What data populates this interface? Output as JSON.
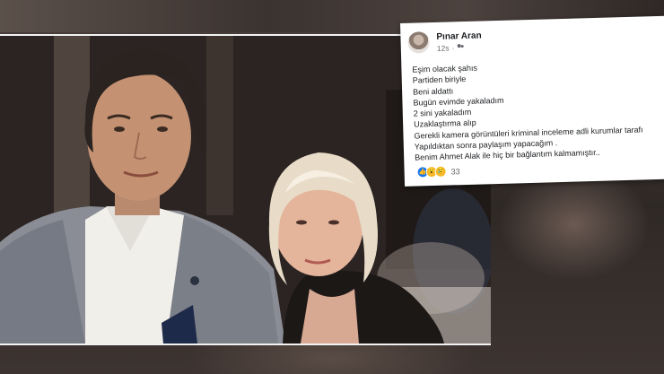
{
  "post": {
    "author": "Pınar Aran",
    "time": "12s",
    "audience_icon": "friends-icon",
    "lines": [
      "Eşim olacak şahıs",
      "Partiden biriyle",
      "Beni aldattı",
      "Bugün evimde yakaladım",
      "2 sini yakaladım",
      "Uzaklaştırma alıp",
      "Gerekli kamera görüntüleri kriminal inceleme adli kurumlar tarafı",
      "Yapıldıktan sonra paylaşım yapacağım .",
      "Benim Ahmet Alak ile hiç bir bağlantım kalmamıştır.."
    ],
    "reactions": [
      "like-icon",
      "wow-icon",
      "sad-icon"
    ],
    "reaction_count": "33"
  },
  "colors": {
    "facebook_blue": "#1877f2",
    "text": "#1c1e21",
    "meta": "#65676b"
  }
}
